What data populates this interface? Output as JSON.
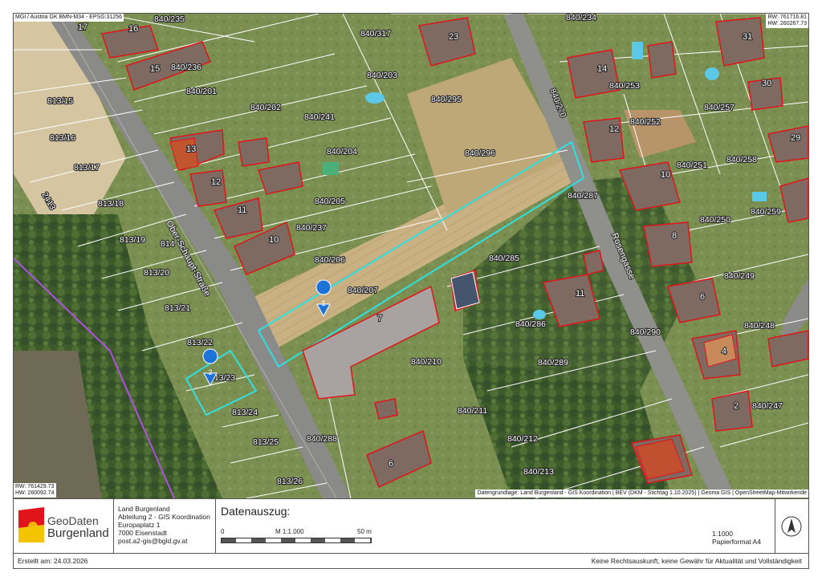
{
  "header": {
    "info_top": "MGI / Austria GK BMN-M34 - EPSG:31256",
    "coord_top_right_rw": "RW: 761716.81",
    "coord_top_right_hw": "HW: 260267.73",
    "coord_bottom_left_rw": "RW: 761429.73",
    "coord_bottom_left_hw": "HW: 260092.74",
    "attribution": "Datengrundlage: Land Burgenland - GIS Koordination | BEV (DKM - Stichtag 1.10.2025) | Geoma GIS | OpenStreetMap-Mitwirkende"
  },
  "streets": {
    "main": "Ober-Schaupt-Straße",
    "side": "Rosengasse",
    "parcel_main": "814",
    "parcel_side": "840/270"
  },
  "markers": [
    {
      "label": "1"
    },
    {
      "label": "2"
    }
  ],
  "parcels": [
    "840/235",
    "840/317",
    "840/234",
    "813/15",
    "840/236",
    "840/203",
    "840/201",
    "840/202",
    "840/241",
    "840/295",
    "813/16",
    "813/17",
    "840/204",
    "840/296",
    "840/205",
    "840/237",
    "813/18",
    "813/19",
    "840/206",
    "840/207",
    "840/285",
    "813/20",
    "813/21",
    "813/22",
    "813/23",
    "813/24",
    "813/25",
    "813/26",
    "840/288",
    "840/210",
    "840/211",
    "840/212",
    "840/213",
    "840/286",
    "840/289",
    "840/290",
    "840/287",
    "840/253",
    "840/252",
    "840/257",
    "840/251",
    "840/258",
    "840/250",
    "840/259",
    "840/249",
    "840/248",
    "840/247",
    "2413"
  ],
  "houses": [
    "17",
    "16",
    "15",
    "23",
    "14",
    "31",
    "30",
    "13",
    "12",
    "11",
    "10",
    "29",
    "10",
    "8",
    "6",
    "4",
    "2",
    "12",
    "11",
    "7",
    "6"
  ],
  "colors": {
    "parcel_line": "#ffffff",
    "building_outline": "#e0141a",
    "highlight": "#2fe0e0",
    "marker": "#1e73d8",
    "boundary_purple": "#b050e0"
  },
  "footer": {
    "logo_geo": "GeoDaten",
    "logo_region": "Burgenland",
    "address_lines": [
      "Land Burgenland",
      "Abteilung 2 - GIS Koordination",
      "Europaplatz 1",
      "7000 Eisenstadt",
      "post.a2-gis@bgld.gv.at"
    ],
    "title": "Datenauszug:",
    "scale_start": "0",
    "scale_label": "M 1:1.000",
    "scale_end": "50 m",
    "scale_ratio": "1:1000",
    "paper_format": "Papierformat A4",
    "created": "Erstellt am: 24.03.2026",
    "disclaimer": "Keine Rechtsauskunft, keine Gewähr für Aktualität und Vollständigkeit"
  }
}
